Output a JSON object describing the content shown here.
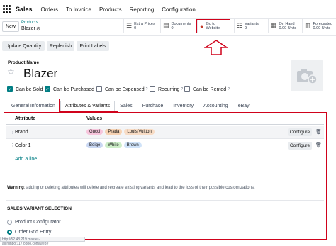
{
  "topbar": {
    "app_name": "Sales",
    "menu": [
      "Orders",
      "To Invoice",
      "Products",
      "Reporting",
      "Configuration"
    ]
  },
  "control_panel": {
    "new_label": "New",
    "breadcrumb_parent": "Products",
    "breadcrumb_current": "Blazer",
    "stats": [
      {
        "icon": "list-icon",
        "line1": "Extra Prices",
        "line2": "0"
      },
      {
        "icon": "document-icon",
        "line1": "Documents",
        "line2": "0"
      },
      {
        "icon": "globe-icon",
        "line1": "Go to",
        "line2": "Website"
      },
      {
        "icon": "variants-icon",
        "line1": "Variants",
        "line2": "9"
      },
      {
        "icon": "cubes-icon",
        "line1": "On Hand",
        "line2": "0.00 Units"
      },
      {
        "icon": "forecast-icon",
        "line1": "Forecasted",
        "line2": "0.00 Units"
      }
    ]
  },
  "actions": [
    "Update Quantity",
    "Replenish",
    "Print Labels"
  ],
  "product": {
    "label": "Product Name",
    "name": "Blazer",
    "checks": [
      {
        "label": "Can be Sold",
        "checked": true,
        "help": ""
      },
      {
        "label": "Can be Purchased",
        "checked": true,
        "help": ""
      },
      {
        "label": "Can be Expensed",
        "checked": false,
        "help": "?"
      },
      {
        "label": "Recurring",
        "checked": false,
        "help": "?"
      },
      {
        "label": "Can be Rented",
        "checked": false,
        "help": "?"
      }
    ]
  },
  "tabs": [
    "General Information",
    "Attributes & Variants",
    "Sales",
    "Purchase",
    "Inventory",
    "Accounting",
    "eBay"
  ],
  "attributes": {
    "col_attribute": "Attribute",
    "col_values": "Values",
    "rows": [
      {
        "name": "Brand",
        "values": [
          {
            "label": "Gucci",
            "color": "#f7c5dc"
          },
          {
            "label": "Prada",
            "color": "#f6d2b3"
          },
          {
            "label": "Louis Vuitton",
            "color": "#f8dcc5"
          }
        ],
        "configure": "Configure"
      },
      {
        "name": "Color 1",
        "values": [
          {
            "label": "Beige",
            "color": "#c9d7f2"
          },
          {
            "label": "White",
            "color": "#cdeec8"
          },
          {
            "label": "Brown",
            "color": "#cfe2f8"
          }
        ],
        "configure": "Configure"
      }
    ],
    "add_line": "Add a line"
  },
  "warning": {
    "bold": "Warning",
    "text": ": adding or deleting attributes will delete and recreate existing variants and lead to the loss of their possible customizations."
  },
  "sales_variant": {
    "title": "SALES VARIANT SELECTION",
    "options": [
      {
        "label": "Product Configurator",
        "selected": false
      },
      {
        "label": "Order Grid Entry",
        "selected": true
      }
    ]
  },
  "status_url": "http://52.48.219.master-all.runbot117.odoo.com/web#"
}
